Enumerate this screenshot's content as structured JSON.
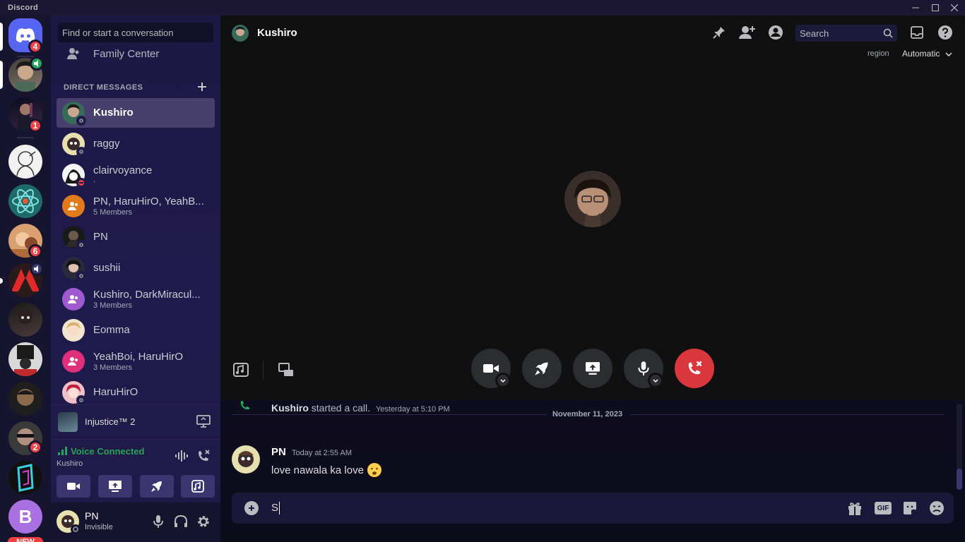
{
  "app": {
    "title": "Discord"
  },
  "colors": {
    "accent": "#5865f2",
    "online": "#23a55a",
    "danger": "#f23f43"
  },
  "guilds": {
    "items": [
      {
        "name": "home",
        "badge": "4"
      },
      {
        "name": "voice-server",
        "badge": ""
      },
      {
        "name": "server-3",
        "badge": "1"
      },
      {
        "name": "server-4",
        "badge": ""
      },
      {
        "name": "server-5",
        "badge": ""
      },
      {
        "name": "server-6",
        "badge": "6"
      },
      {
        "name": "server-7",
        "badge": ""
      },
      {
        "name": "server-8",
        "badge": ""
      },
      {
        "name": "server-9",
        "badge": ""
      },
      {
        "name": "server-10",
        "badge": ""
      },
      {
        "name": "server-11",
        "badge": "2"
      },
      {
        "name": "server-12",
        "badge": ""
      }
    ],
    "new_badge": "NEW",
    "bottom_letter": "B"
  },
  "sidebar": {
    "search_placeholder": "Find or start a conversation",
    "family_center": "Family Center",
    "dm_header": "DIRECT MESSAGES",
    "dms": [
      {
        "name": "Kushiro",
        "sub": ""
      },
      {
        "name": "raggy",
        "sub": ""
      },
      {
        "name": "clairvoyance",
        "sub": "."
      },
      {
        "name": "PN, HaruHirO, YeahB...",
        "sub": "5 Members"
      },
      {
        "name": "PN",
        "sub": ""
      },
      {
        "name": "sushii",
        "sub": ""
      },
      {
        "name": "Kushiro, DarkMiracul...",
        "sub": "3 Members"
      },
      {
        "name": "Eomma",
        "sub": ""
      },
      {
        "name": "YeahBoi, HaruHirO",
        "sub": "3 Members"
      },
      {
        "name": "HaruHirO",
        "sub": ""
      }
    ],
    "activity": {
      "game": "Injustice™ 2"
    },
    "voice": {
      "status": "Voice Connected",
      "channel": "Kushiro"
    },
    "user": {
      "name": "PN",
      "status": "Invisible"
    }
  },
  "call": {
    "header_name": "Kushiro",
    "search_placeholder": "Search",
    "region_label": "region",
    "region_value": "Automatic"
  },
  "chat": {
    "system_author": "Kushiro",
    "system_text": "started a call.",
    "system_time": "Yesterday at 5:10 PM",
    "date_divider": "November 11, 2023",
    "message": {
      "author": "PN",
      "time": "Today at 2:55 AM",
      "text": "love nawala ka love"
    },
    "composer_value": "S",
    "gif_label": "GIF"
  }
}
